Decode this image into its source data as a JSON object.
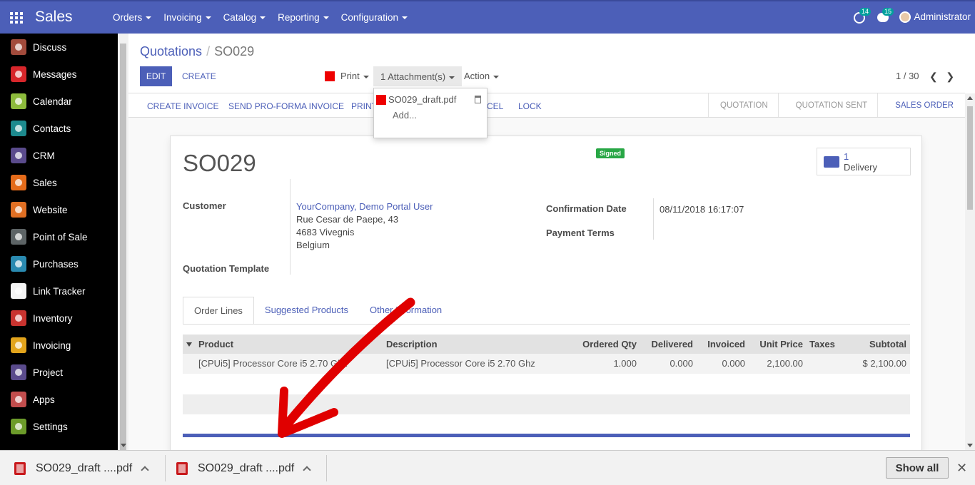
{
  "topbar": {
    "app_title": "Sales",
    "menu": [
      "Orders",
      "Invoicing",
      "Catalog",
      "Reporting",
      "Configuration"
    ],
    "activity_count": "14",
    "message_count": "15",
    "user": "Administrator",
    "color": "#4c5fb8"
  },
  "sidebar": {
    "items": [
      {
        "label": "Discuss",
        "icon": "discuss-icon",
        "color": "#a24b3c"
      },
      {
        "label": "Messages",
        "icon": "messages-icon",
        "color": "#d7262b"
      },
      {
        "label": "Calendar",
        "icon": "calendar-icon",
        "color": "#8dbb3c"
      },
      {
        "label": "Contacts",
        "icon": "contacts-icon",
        "color": "#1d8a8e"
      },
      {
        "label": "CRM",
        "icon": "crm-icon",
        "color": "#5a4b8c"
      },
      {
        "label": "Sales",
        "icon": "sales-icon",
        "color": "#e46b1a"
      },
      {
        "label": "Website",
        "icon": "website-icon",
        "color": "#e06f23"
      },
      {
        "label": "Point of Sale",
        "icon": "point-of-sale-icon",
        "color": "#5d6466"
      },
      {
        "label": "Purchases",
        "icon": "purchases-icon",
        "color": "#2a8ab0"
      },
      {
        "label": "Link Tracker",
        "icon": "link-tracker-icon",
        "color": "#f4f4f4"
      },
      {
        "label": "Inventory",
        "icon": "inventory-icon",
        "color": "#c9332f"
      },
      {
        "label": "Invoicing",
        "icon": "invoicing-icon",
        "color": "#e2a41c"
      },
      {
        "label": "Project",
        "icon": "project-icon",
        "color": "#5a4b8c"
      },
      {
        "label": "Apps",
        "icon": "apps-icon",
        "color": "#c24d4d"
      },
      {
        "label": "Settings",
        "icon": "settings-icon",
        "color": "#6c9b2a"
      }
    ]
  },
  "breadcrumb": {
    "parent": "Quotations",
    "separator": "/",
    "current": "SO029"
  },
  "toolbar": {
    "edit": "EDIT",
    "create": "CREATE",
    "print": "Print",
    "attachments": "1 Attachment(s)",
    "action": "Action",
    "pager": "1 / 30"
  },
  "attachments_dropdown": {
    "file": "SO029_draft.pdf",
    "add": "Add..."
  },
  "statusbar": {
    "buttons": [
      "CREATE INVOICE",
      "SEND PRO-FORMA INVOICE",
      "PRINT",
      "CEL",
      "LOCK"
    ],
    "states": [
      "QUOTATION",
      "QUOTATION SENT",
      "SALES ORDER"
    ],
    "active_state": "SALES ORDER"
  },
  "order": {
    "name": "SO029",
    "badge": "Signed",
    "delivery_count": "1",
    "delivery_label": "Delivery",
    "customer_label": "Customer",
    "customer_name": "YourCompany, Demo Portal User",
    "address_lines": [
      "Rue Cesar de Paepe, 43",
      "4683 Vivegnis",
      "Belgium"
    ],
    "template_label": "Quotation Template",
    "confirmation_label": "Confirmation Date",
    "confirmation_date": "08/11/2018 16:17:07",
    "payment_label": "Payment Terms"
  },
  "tabs": [
    "Order Lines",
    "Suggested Products",
    "Other Information"
  ],
  "table": {
    "headers": {
      "product": "Product",
      "description": "Description",
      "ordered": "Ordered Qty",
      "delivered": "Delivered",
      "invoiced": "Invoiced",
      "unit_price": "Unit Price",
      "taxes": "Taxes",
      "subtotal": "Subtotal"
    },
    "rows": [
      {
        "product": "[CPUi5] Processor Core i5 2.70 Ghz",
        "description": "[CPUi5] Processor Core i5 2.70 Ghz",
        "ordered": "1.000",
        "delivered": "0.000",
        "invoiced": "0.000",
        "unit_price": "2,100.00",
        "taxes": "",
        "subtotal": "$ 2,100.00"
      }
    ]
  },
  "downloads": {
    "items": [
      "SO029_draft ....pdf",
      "SO029_draft ....pdf"
    ],
    "show_all": "Show all",
    "close": "✕"
  }
}
